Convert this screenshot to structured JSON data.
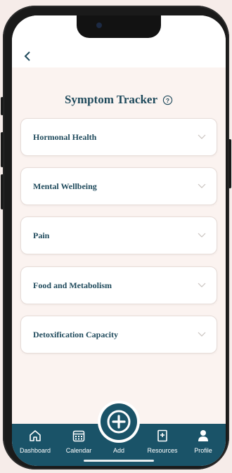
{
  "header": {
    "title": "Symptom Tracker"
  },
  "categories": [
    {
      "label": "Hormonal Health"
    },
    {
      "label": "Mental Wellbeing"
    },
    {
      "label": "Pain"
    },
    {
      "label": "Food and Metabolism"
    },
    {
      "label": "Detoxification Capacity"
    }
  ],
  "nav": {
    "items": [
      {
        "label": "Dashboard",
        "icon": "home-icon"
      },
      {
        "label": "Calendar",
        "icon": "calendar-icon"
      },
      {
        "label": "Add",
        "icon": "plus-icon"
      },
      {
        "label": "Resources",
        "icon": "book-icon"
      },
      {
        "label": "Profile",
        "icon": "person-icon"
      }
    ]
  },
  "colors": {
    "primary": "#1a5368",
    "text": "#1f4a5c",
    "background": "#fbf3f0"
  }
}
